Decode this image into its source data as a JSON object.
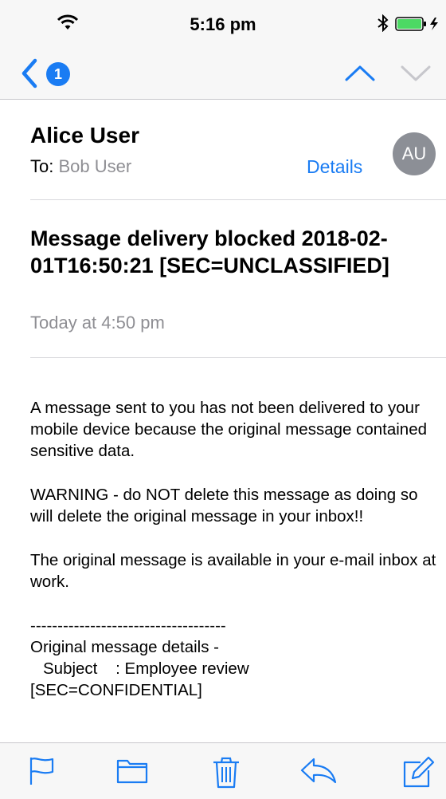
{
  "status_bar": {
    "time": "5:16 pm"
  },
  "nav": {
    "unread_count": "1"
  },
  "email": {
    "sender": "Alice User",
    "to_label": "To:",
    "to_name": "Bob User",
    "details_label": "Details",
    "avatar_initials": "AU",
    "subject": "Message delivery blocked 2018-02-01T16:50:21 [SEC=UNCLASSIFIED]",
    "date": "Today at 4:50 pm",
    "body": {
      "p1": "A message sent to you has not been delivered to your mobile device because the original message contained sensitive data.",
      "p2": "WARNING - do NOT delete this message as doing so will delete the original message in your inbox!!",
      "p3": "The original message is available in your e-mail inbox at work.",
      "separator": "------------------------------------",
      "details_heading": "Original message details -",
      "details_subject": "Subject    : Employee review",
      "details_subject_cont": "[SEC=CONFIDENTIAL]"
    }
  },
  "icons": {
    "back": "chevron-left-icon",
    "up": "chevron-up-icon",
    "down": "chevron-down-icon",
    "flag": "flag-icon",
    "folder": "folder-icon",
    "trash": "trash-icon",
    "reply": "reply-icon",
    "compose": "compose-icon"
  },
  "colors": {
    "accent": "#1a7cf3",
    "secondary_text": "#8e8e93",
    "battery": "#4cd964"
  }
}
